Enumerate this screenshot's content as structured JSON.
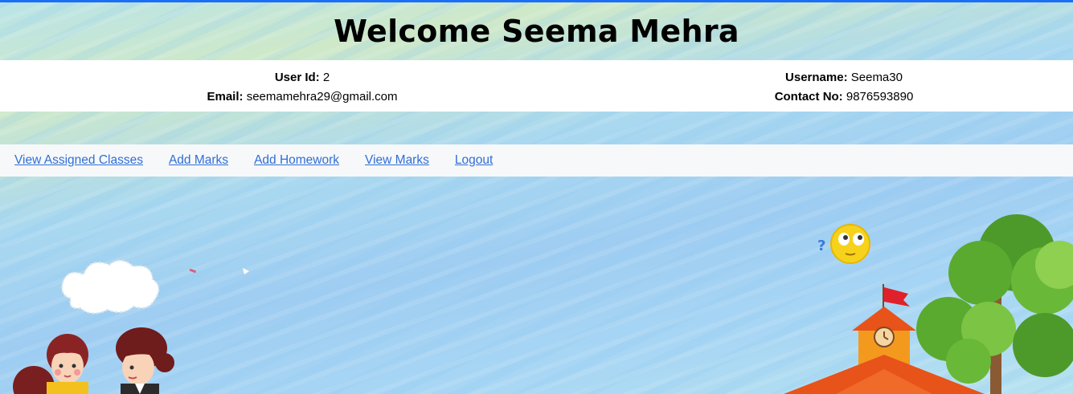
{
  "header": {
    "title": "Welcome Seema Mehra"
  },
  "user_info": {
    "user_id_label": "User Id:",
    "user_id": "2",
    "email_label": "Email:",
    "email": "seemamehra29@gmail.com",
    "username_label": "Username:",
    "username": "Seema30",
    "contact_label": "Contact No:",
    "contact": "9876593890"
  },
  "nav": {
    "items": [
      {
        "label": "View Assigned Classes"
      },
      {
        "label": "Add Marks"
      },
      {
        "label": "Add Homework"
      },
      {
        "label": "View Marks"
      },
      {
        "label": "Logout"
      }
    ]
  },
  "colors": {
    "accent_bar": "#1a6ff5",
    "link": "#2f6fd6",
    "navbar_bg": "#f7f8fa"
  },
  "icons": [
    "cloud-icon",
    "emoji-thinking-icon",
    "question-mark-icon",
    "school-building-icon",
    "flag-icon",
    "clock-icon",
    "tree-icon",
    "student-girl-icon",
    "student-boy-icon"
  ]
}
